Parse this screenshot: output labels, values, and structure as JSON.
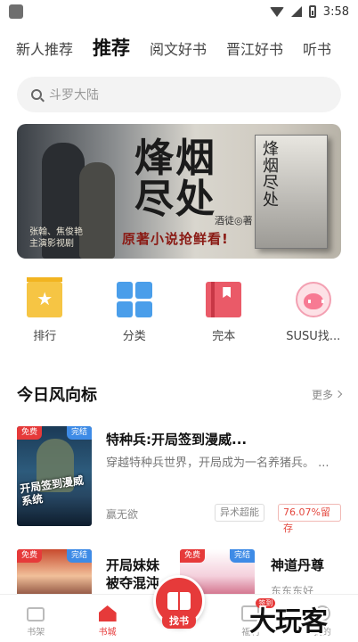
{
  "status_bar": {
    "time": "3:58",
    "icons": [
      "wifi-icon",
      "cellular-icon",
      "battery-icon"
    ]
  },
  "tabs": [
    {
      "label": "新人推荐",
      "active": false
    },
    {
      "label": "推荐",
      "active": true
    },
    {
      "label": "阅文好书",
      "active": false
    },
    {
      "label": "晋江好书",
      "active": false
    },
    {
      "label": "听书",
      "active": false
    }
  ],
  "search": {
    "placeholder": "斗罗大陆",
    "icon": "search-icon"
  },
  "banner": {
    "title_line1": "烽烟",
    "title_line2": "尽处",
    "author": "酒徒◎著",
    "slogan": "原著小说抢鲜看!",
    "cast_line1": "张翰、焦俊艳",
    "cast_line2": "主演影视剧",
    "book_title": "烽烟尽处"
  },
  "categories": [
    {
      "label": "排行",
      "icon": "ranking-icon"
    },
    {
      "label": "分类",
      "icon": "category-grid-icon"
    },
    {
      "label": "完本",
      "icon": "finished-book-icon"
    },
    {
      "label": "SUSU找...",
      "icon": "susu-mascot-icon"
    }
  ],
  "section": {
    "title": "今日风向标",
    "more": "更多"
  },
  "featured_book": {
    "title": "特种兵:开局签到漫威...",
    "description": "穿越特种兵世界，开局成为一名养猪兵。 ...",
    "author": "赢无欲",
    "genre_tag": "异术超能",
    "retention_tag": "76.07%留存",
    "badge_free": "免费",
    "badge_finished": "完结",
    "cover_text": "开局签到漫威系统"
  },
  "second_row": [
    {
      "title_line1": "开局妹妹",
      "title_line2": "被夺混沌",
      "badge_free": "免费",
      "badge_finished": "完结"
    },
    {
      "title": "神道丹尊",
      "author": "东东东好",
      "badge_free": "免费",
      "badge_finished": "完结"
    }
  ],
  "bottom_nav": [
    {
      "label": "书架",
      "icon": "bookshelf-icon",
      "active": false
    },
    {
      "label": "书城",
      "icon": "bookstore-home-icon",
      "active": true
    },
    {
      "label": "找书",
      "icon": "open-book-icon",
      "active": false
    },
    {
      "label": "福利",
      "icon": "welfare-icon",
      "active": false,
      "badge": "签到"
    },
    {
      "label": "我的",
      "icon": "profile-icon",
      "active": false
    }
  ],
  "watermark": "大玩客",
  "colors": {
    "accent": "#e63a3a",
    "tag_rate": "#e4483f",
    "badge_blue": "#3e8be6"
  }
}
